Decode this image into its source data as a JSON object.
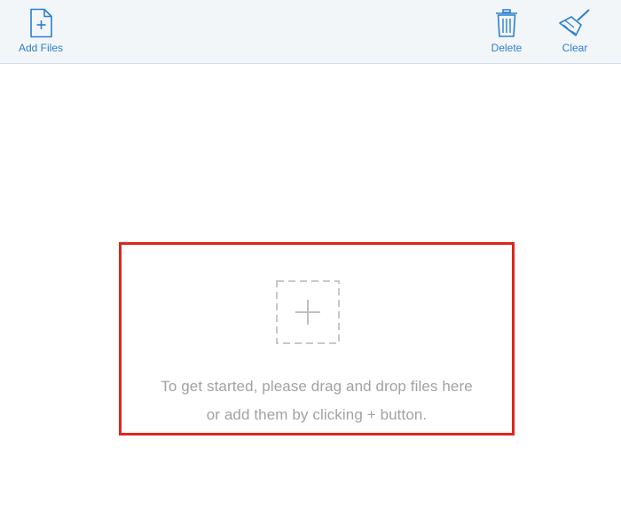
{
  "toolbar": {
    "add_files": {
      "label": "Add Files",
      "icon": "add-file-icon"
    },
    "delete": {
      "label": "Delete",
      "icon": "trash-icon"
    },
    "clear": {
      "label": "Clear",
      "icon": "broom-icon"
    }
  },
  "dropzone": {
    "icon": "add-placeholder-icon",
    "line1": "To get started, please drag and drop files here",
    "line2": "or add them by clicking + button."
  },
  "colors": {
    "toolbar_bg": "#f3f6f9",
    "accent": "#2a7fd0",
    "highlight_border": "#e0251f",
    "hint_text": "#a2a2a2"
  }
}
